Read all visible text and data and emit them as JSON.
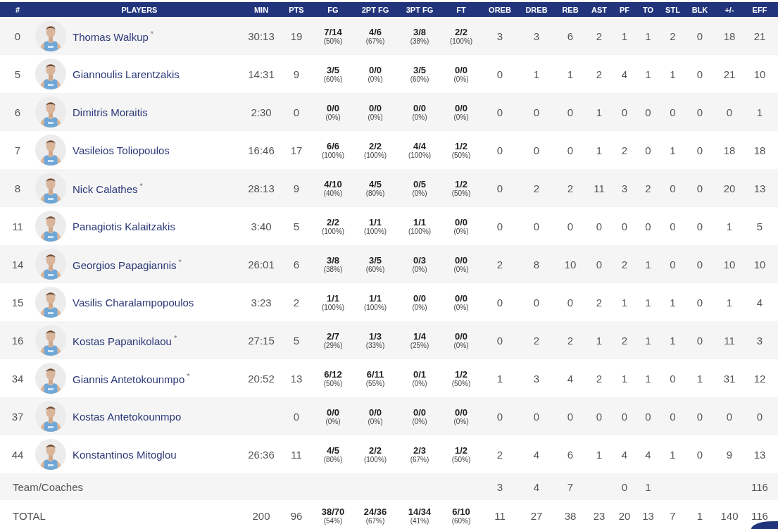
{
  "columns": [
    "#",
    "PLAYERS",
    "MIN",
    "PTS",
    "FG",
    "2PT FG",
    "3PT FG",
    "FT",
    "OREB",
    "DREB",
    "REB",
    "AST",
    "PF",
    "TO",
    "STL",
    "BLK",
    "+/-",
    "EFF"
  ],
  "players": [
    {
      "number": "0",
      "name": "Thomas Walkup",
      "marker": "*",
      "min": "30:13",
      "pts": "19",
      "shots": [
        [
          "7/14",
          "(50%)"
        ],
        [
          "4/6",
          "(67%)"
        ],
        [
          "3/8",
          "(38%)"
        ],
        [
          "2/2",
          "(100%)"
        ]
      ],
      "stats": [
        "3",
        "3",
        "6",
        "2",
        "1",
        "1",
        "2",
        "0",
        "18",
        "21"
      ]
    },
    {
      "number": "5",
      "name": "Giannoulis Larentzakis",
      "min": "14:31",
      "pts": "9",
      "shots": [
        [
          "3/5",
          "(60%)"
        ],
        [
          "0/0",
          "(0%)"
        ],
        [
          "3/5",
          "(60%)"
        ],
        [
          "0/0",
          "(0%)"
        ]
      ],
      "stats": [
        "0",
        "1",
        "1",
        "2",
        "4",
        "1",
        "1",
        "0",
        "21",
        "10"
      ]
    },
    {
      "number": "6",
      "name": "Dimitris Moraitis",
      "min": "2:30",
      "pts": "0",
      "shots": [
        [
          "0/0",
          "(0%)"
        ],
        [
          "0/0",
          "(0%)"
        ],
        [
          "0/0",
          "(0%)"
        ],
        [
          "0/0",
          "(0%)"
        ]
      ],
      "stats": [
        "0",
        "0",
        "0",
        "1",
        "0",
        "0",
        "0",
        "0",
        "0",
        "1"
      ]
    },
    {
      "number": "7",
      "name": "Vasileios Toliopoulos",
      "min": "16:46",
      "pts": "17",
      "shots": [
        [
          "6/6",
          "(100%)"
        ],
        [
          "2/2",
          "(100%)"
        ],
        [
          "4/4",
          "(100%)"
        ],
        [
          "1/2",
          "(50%)"
        ]
      ],
      "stats": [
        "0",
        "0",
        "0",
        "1",
        "2",
        "0",
        "1",
        "0",
        "18",
        "18"
      ]
    },
    {
      "number": "8",
      "name": "Nick Calathes",
      "marker": "*",
      "min": "28:13",
      "pts": "9",
      "shots": [
        [
          "4/10",
          "(40%)"
        ],
        [
          "4/5",
          "(80%)"
        ],
        [
          "0/5",
          "(0%)"
        ],
        [
          "1/2",
          "(50%)"
        ]
      ],
      "stats": [
        "0",
        "2",
        "2",
        "11",
        "3",
        "2",
        "0",
        "0",
        "20",
        "13"
      ]
    },
    {
      "number": "11",
      "name": "Panagiotis Kalaitzakis",
      "min": "3:40",
      "pts": "5",
      "shots": [
        [
          "2/2",
          "(100%)"
        ],
        [
          "1/1",
          "(100%)"
        ],
        [
          "1/1",
          "(100%)"
        ],
        [
          "0/0",
          "(0%)"
        ]
      ],
      "stats": [
        "0",
        "0",
        "0",
        "0",
        "0",
        "0",
        "0",
        "0",
        "1",
        "5"
      ]
    },
    {
      "number": "14",
      "name": "Georgios Papagiannis",
      "marker": "*",
      "min": "26:01",
      "pts": "6",
      "shots": [
        [
          "3/8",
          "(38%)"
        ],
        [
          "3/5",
          "(60%)"
        ],
        [
          "0/3",
          "(0%)"
        ],
        [
          "0/0",
          "(0%)"
        ]
      ],
      "stats": [
        "2",
        "8",
        "10",
        "0",
        "2",
        "1",
        "0",
        "0",
        "10",
        "10"
      ]
    },
    {
      "number": "15",
      "name": "Vasilis Charalampopoulos",
      "min": "3:23",
      "pts": "2",
      "shots": [
        [
          "1/1",
          "(100%)"
        ],
        [
          "1/1",
          "(100%)"
        ],
        [
          "0/0",
          "(0%)"
        ],
        [
          "0/0",
          "(0%)"
        ]
      ],
      "stats": [
        "0",
        "0",
        "0",
        "2",
        "1",
        "1",
        "1",
        "0",
        "1",
        "4"
      ]
    },
    {
      "number": "16",
      "name": "Kostas Papanikolaou",
      "marker": "*",
      "min": "27:15",
      "pts": "5",
      "shots": [
        [
          "2/7",
          "(29%)"
        ],
        [
          "1/3",
          "(33%)"
        ],
        [
          "1/4",
          "(25%)"
        ],
        [
          "0/0",
          "(0%)"
        ]
      ],
      "stats": [
        "0",
        "2",
        "2",
        "1",
        "2",
        "1",
        "1",
        "0",
        "11",
        "3"
      ]
    },
    {
      "number": "34",
      "name": "Giannis Antetokounmpo",
      "marker": "*",
      "min": "20:52",
      "pts": "13",
      "shots": [
        [
          "6/12",
          "(50%)"
        ],
        [
          "6/11",
          "(55%)"
        ],
        [
          "0/1",
          "(0%)"
        ],
        [
          "1/2",
          "(50%)"
        ]
      ],
      "stats": [
        "1",
        "3",
        "4",
        "2",
        "1",
        "1",
        "0",
        "1",
        "31",
        "12"
      ]
    },
    {
      "number": "37",
      "name": "Kostas Antetokounmpo",
      "pts": "0",
      "shots": [
        [
          "0/0",
          "(0%)"
        ],
        [
          "0/0",
          "(0%)"
        ],
        [
          "0/0",
          "(0%)"
        ],
        [
          "0/0",
          "(0%)"
        ]
      ],
      "stats": [
        "0",
        "0",
        "0",
        "0",
        "0",
        "0",
        "0",
        "0",
        "0",
        "0"
      ]
    },
    {
      "number": "44",
      "name": "Konstantinos Mitoglou",
      "min": "26:36",
      "pts": "11",
      "shots": [
        [
          "4/5",
          "(80%)"
        ],
        [
          "2/2",
          "(100%)"
        ],
        [
          "2/3",
          "(67%)"
        ],
        [
          "1/2",
          "(50%)"
        ]
      ],
      "stats": [
        "2",
        "4",
        "6",
        "1",
        "4",
        "4",
        "1",
        "0",
        "9",
        "13"
      ]
    }
  ],
  "team": {
    "label": "Team/Coaches",
    "stats": {
      "oreb": "3",
      "dreb": "4",
      "reb": "7",
      "pf": "0",
      "to": "1",
      "eff": "116"
    }
  },
  "total": {
    "label": "TOTAL",
    "min": "200",
    "pts": "96",
    "shots": [
      [
        "38/70",
        "(54%)"
      ],
      [
        "24/36",
        "(67%)"
      ],
      [
        "14/34",
        "(41%)"
      ],
      [
        "6/10",
        "(60%)"
      ]
    ],
    "stats": [
      "11",
      "27",
      "38",
      "23",
      "20",
      "13",
      "7",
      "1",
      "140",
      "116"
    ]
  }
}
